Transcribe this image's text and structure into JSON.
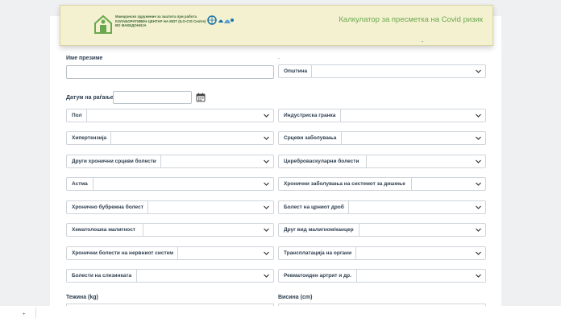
{
  "header": {
    "logo_lines": [
      "Македонско здружение за заштита при работа",
      "КОЛАБОРАТИВЕН ЦЕНТАР НА МОТ (ILO-CIS Centre)",
      "ВО МАКЕДОНИЈА"
    ],
    "title": "Калкулатор за пресметка на Covid ризик",
    "dot": "."
  },
  "form": {
    "name_label": "Име презиме",
    "municipality_dot": ".",
    "municipality_label": "Општина",
    "dob_label": "Датум на раѓање:",
    "selects_left": [
      "Пол",
      "Хипертензија",
      "Други хронични срцеви болести",
      "Астма",
      "Хронично бубрежна болест",
      "Хематолошка малигност",
      "Хронични болести на нервниот систем",
      "Болести на слезинката"
    ],
    "selects_right": [
      "Индустриска гранка",
      "Срцеви заболувања",
      "Цереброваскуларни болести",
      "Хронични заболувања на системот за дишење",
      "Болест на црниот дроб",
      "Друг вид малигном/канцер",
      "Трансплатација на органи",
      "Ревматоиден артрит и др."
    ],
    "weight_label": "Тежина (kg)",
    "height_label": "Висина (cm)"
  },
  "footer": {
    "mark": "+"
  },
  "colors": {
    "banner": "#f4f1d0",
    "title": "#6aa84f",
    "label": "#2d3e50"
  }
}
